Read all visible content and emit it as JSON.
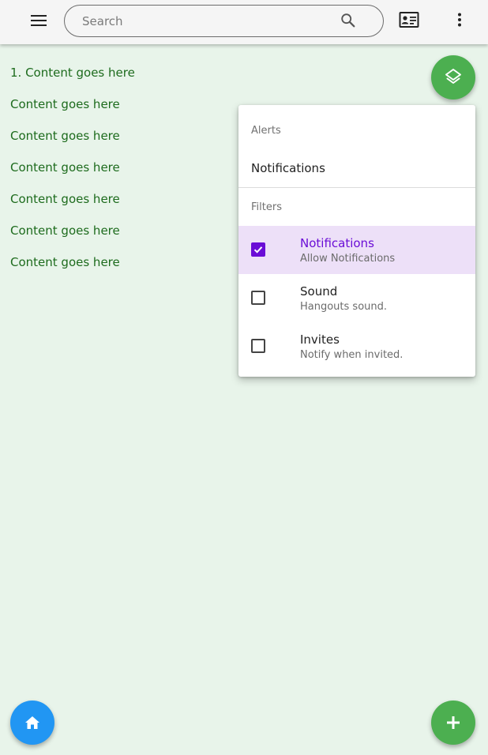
{
  "colors": {
    "appbar_bg": "#f5f5f5",
    "content_bg": "#e8f4ea",
    "content_text": "#1d6b1d",
    "fab_green": "#4caf50",
    "fab_blue": "#2196f3",
    "selected_row_bg": "#ede0f8",
    "accent_purple": "#6a0dd6"
  },
  "appbar": {
    "menu_icon": "hamburger-menu-icon",
    "search": {
      "placeholder": "Search",
      "value": "",
      "icon": "search-icon"
    },
    "contact_card_icon": "contact-card-icon",
    "more_icon": "more-vert-icon"
  },
  "content": {
    "lines": [
      "1. Content goes here",
      "Content goes here",
      "Content goes here",
      "Content goes here",
      "Content goes here",
      "Content goes here",
      "Content goes here"
    ]
  },
  "fabs": {
    "layers_icon": "layers-icon",
    "home_icon": "home-icon",
    "add_icon": "add-icon"
  },
  "menu": {
    "alerts_header": "Alerts",
    "alerts_item": "Notifications",
    "filters_header": "Filters",
    "options": [
      {
        "title": "Notifications",
        "subtitle": "Allow Notifications",
        "checked": true
      },
      {
        "title": "Sound",
        "subtitle": "Hangouts sound.",
        "checked": false
      },
      {
        "title": "Invites",
        "subtitle": "Notify when invited.",
        "checked": false
      }
    ]
  }
}
